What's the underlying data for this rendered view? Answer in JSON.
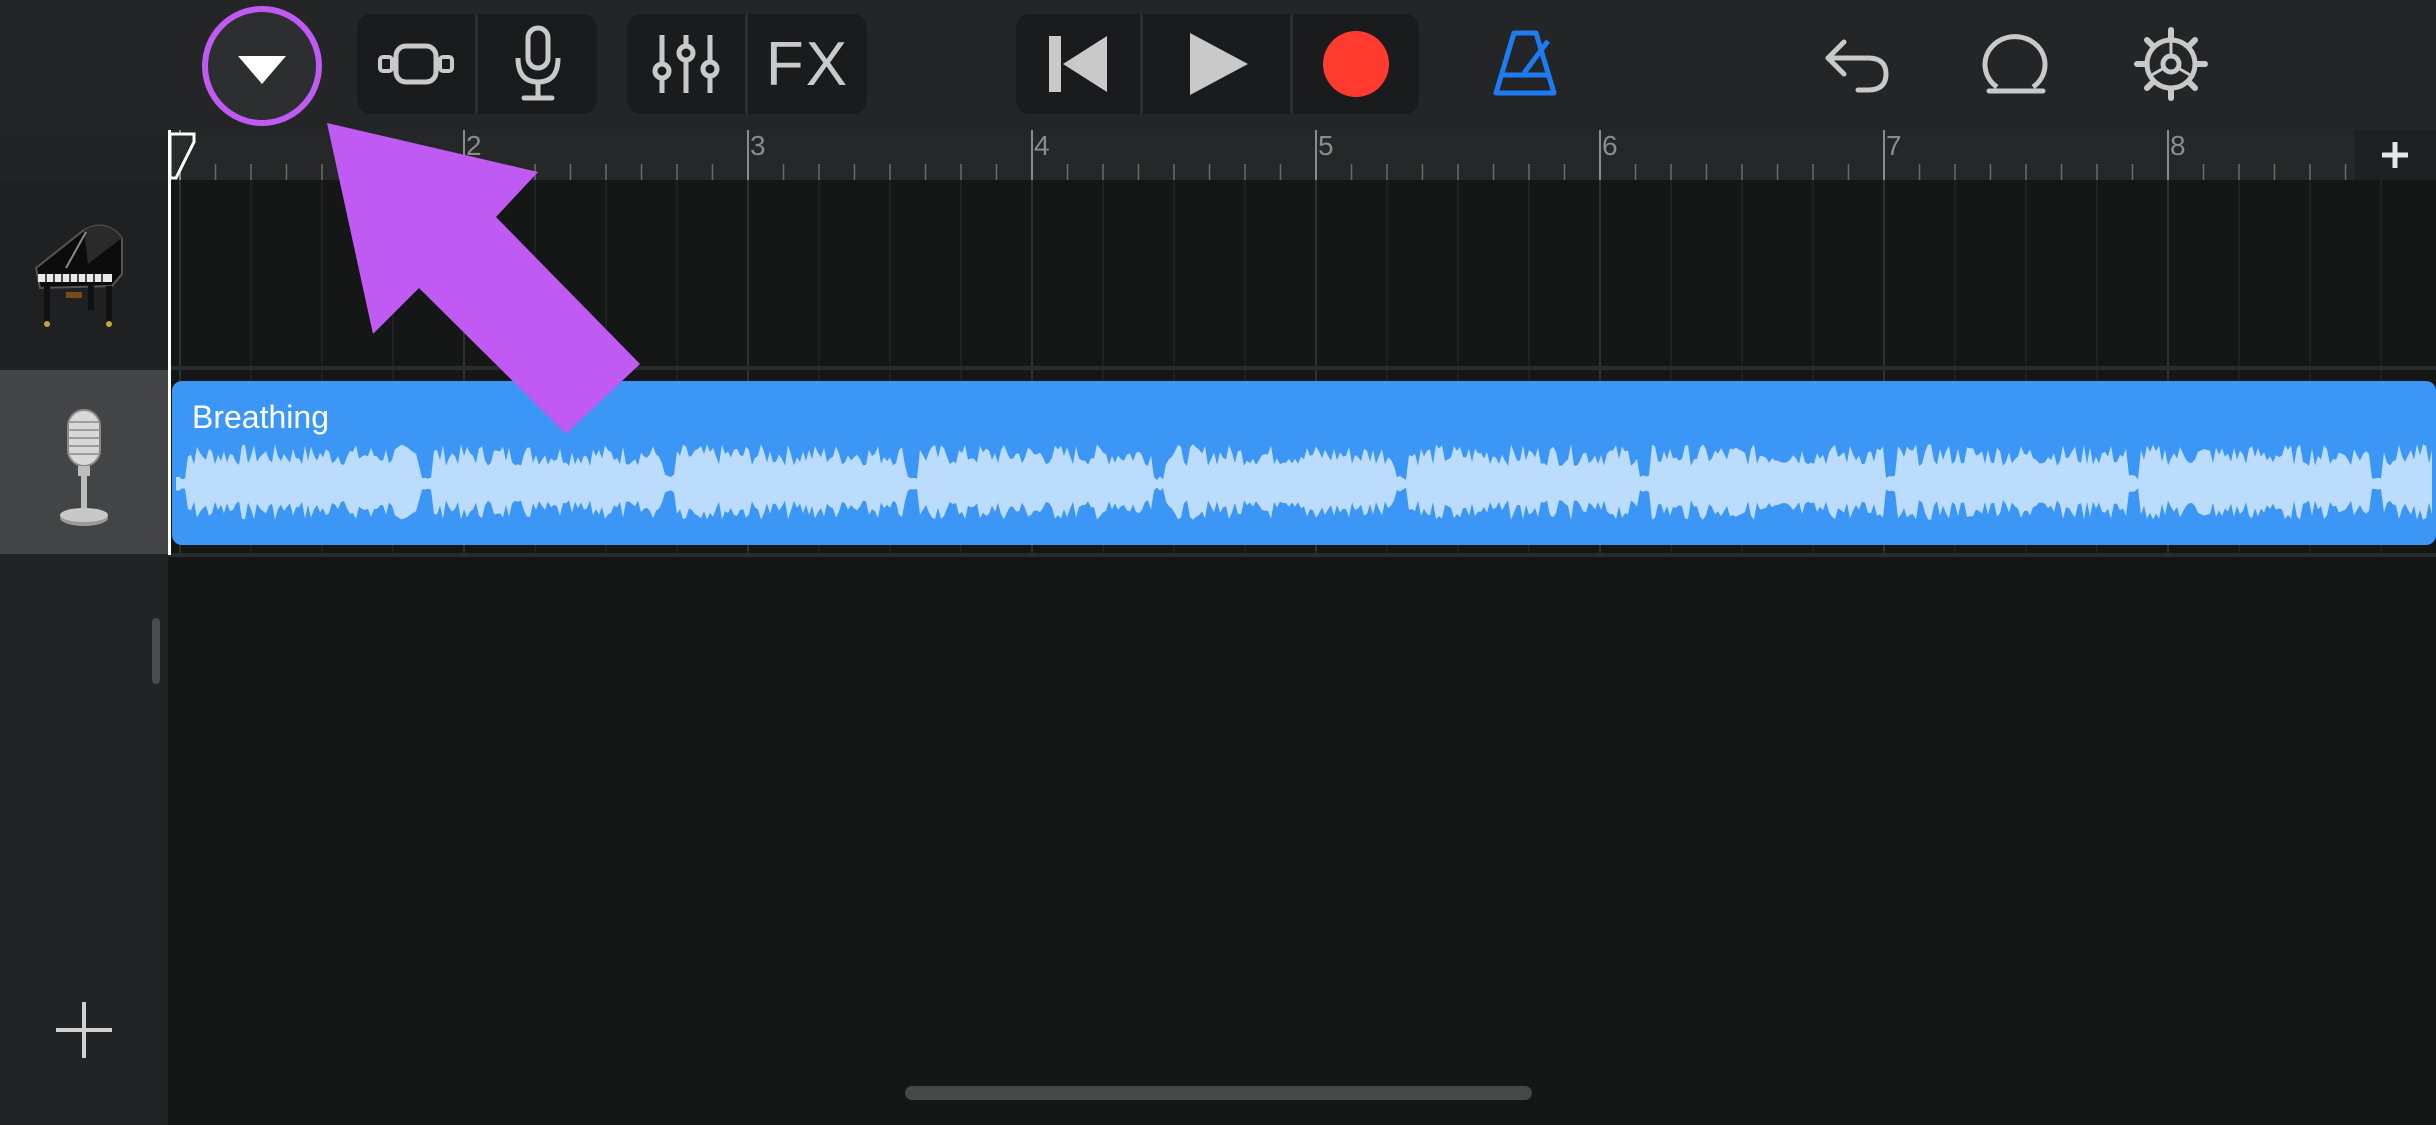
{
  "toolbar": {
    "browser_icon": "chevron-down-icon",
    "view_icon": "tracks-view-icon",
    "instrument_icon": "microphone-icon",
    "mixer_icon": "sliders-icon",
    "fx_label": "FX",
    "rewind_icon": "go-to-beginning-icon",
    "play_icon": "play-icon",
    "record_icon": "record-icon",
    "metronome_icon": "metronome-icon",
    "undo_icon": "undo-icon",
    "loop_icon": "loop-browser-icon",
    "settings_icon": "gear-icon",
    "colors": {
      "record": "#ff3b30",
      "metronome": "#1e7bf2",
      "highlight": "#bf5af2"
    }
  },
  "ruler": {
    "bars": [
      "2",
      "3",
      "4",
      "5",
      "6",
      "7",
      "8"
    ],
    "add_section_icon": "plus-icon"
  },
  "tracks": [
    {
      "name": "Grand Piano",
      "icon": "grand-piano-icon"
    },
    {
      "name": "Audio Recorder",
      "icon": "studio-microphone-icon"
    }
  ],
  "region": {
    "name": "Breathing",
    "color": "#3c96f6",
    "waveform_color": "#bcdcfe"
  },
  "sidebar": {
    "add_track_icon": "plus-icon"
  },
  "annotation": {
    "arrow_color": "#bf5af2"
  }
}
